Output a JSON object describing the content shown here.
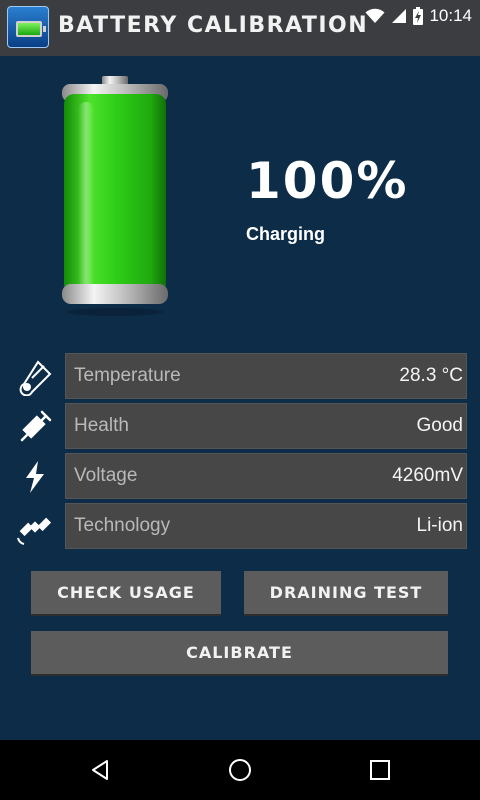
{
  "app": {
    "title": "Battery Calibration"
  },
  "status_bar": {
    "time": "10:14",
    "icons": [
      "wifi-icon",
      "signal-icon",
      "battery-charging-icon"
    ]
  },
  "battery": {
    "percent": "100%",
    "level": 1.0,
    "state": "Charging"
  },
  "stats": [
    {
      "icon": "thermometer-icon",
      "label": "Temperature",
      "value": "28.3 °C"
    },
    {
      "icon": "syringe-icon",
      "label": "Health",
      "value": "Good"
    },
    {
      "icon": "lightning-icon",
      "label": "Voltage",
      "value": "4260mV"
    },
    {
      "icon": "satellite-icon",
      "label": "Technology",
      "value": "Li-ion"
    }
  ],
  "actions": {
    "check_usage": "Check Usage",
    "draining_test": "Draining Test",
    "calibrate": "Calibrate"
  },
  "nav": {
    "icons": [
      "back-icon",
      "home-icon",
      "recents-icon"
    ]
  },
  "colors": {
    "background": "#0c2c48",
    "appbar": "#3b3d40",
    "row": "#474747",
    "button": "#5c5c5c",
    "battery_green": "#2fcf18"
  }
}
